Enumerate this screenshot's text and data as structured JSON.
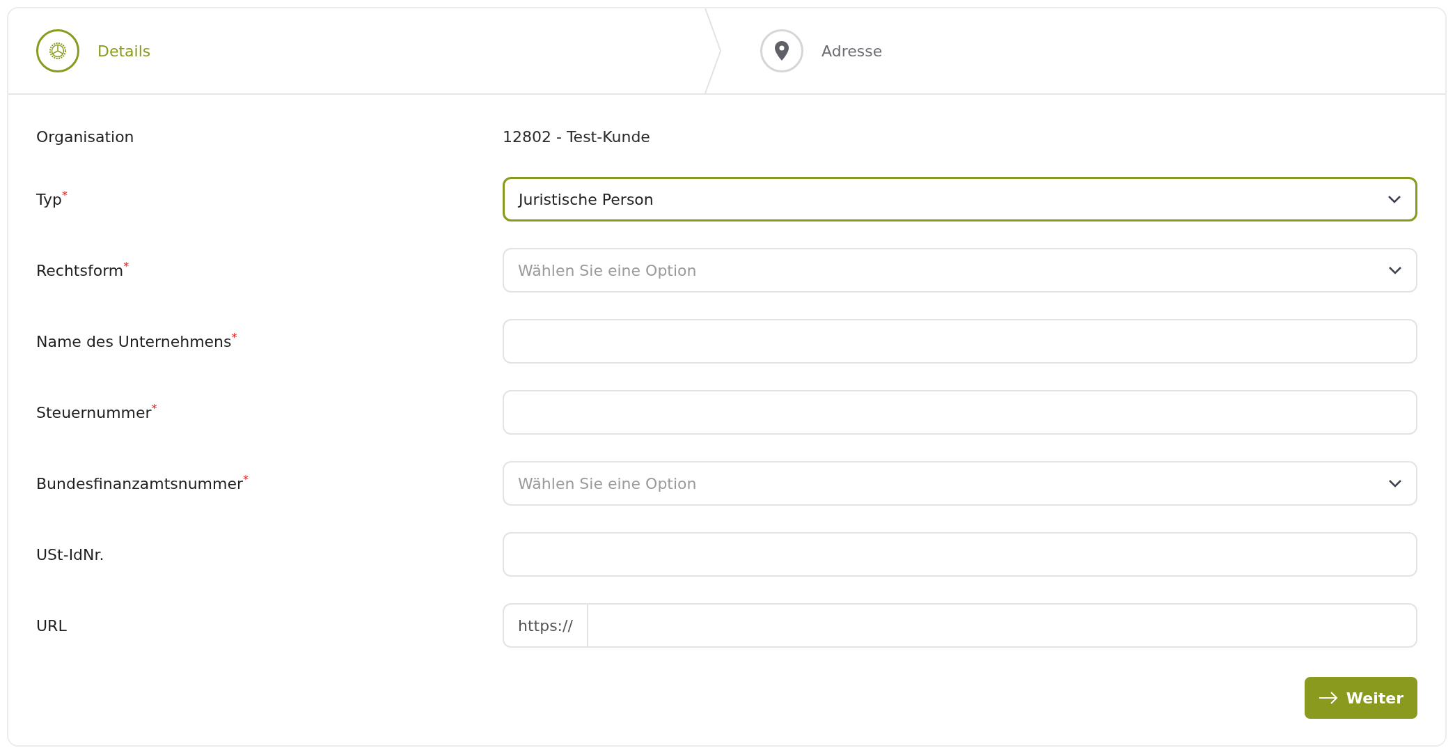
{
  "steps": [
    {
      "label": "Details",
      "selected": true
    },
    {
      "label": "Adresse",
      "selected": false
    }
  ],
  "fields": [
    {
      "kind": "readonly",
      "label": "Organisation",
      "value": "12802 - Test-Kunde"
    },
    {
      "kind": "select",
      "label": "Typ",
      "required_mark": "*",
      "value": "Juristische Person",
      "focused": true
    },
    {
      "kind": "select",
      "label": "Rechtsform",
      "required_mark": "*",
      "placeholder": "Wählen Sie eine Option",
      "focused": false
    },
    {
      "kind": "text",
      "label": "Name des Unternehmens",
      "required_mark": "*",
      "focused": false
    },
    {
      "kind": "text",
      "label": "Steuernummer",
      "required_mark": "*",
      "focused": false
    },
    {
      "kind": "select",
      "label": "Bundesfinanzamtsnummer",
      "required_mark": "*",
      "placeholder": "Wählen Sie eine Option",
      "focused": false
    },
    {
      "kind": "text",
      "label": "USt-IdNr.",
      "focused": false
    },
    {
      "kind": "url",
      "label": "URL",
      "prefix": "https://",
      "focused": false
    }
  ],
  "submit": {
    "label": "Weiter"
  }
}
